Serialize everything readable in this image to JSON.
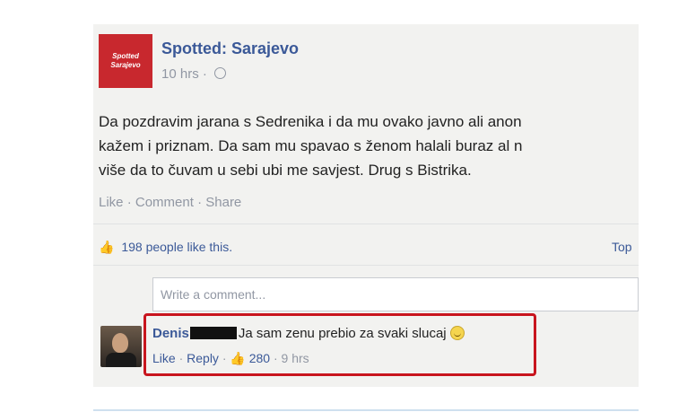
{
  "post": {
    "page_name": "Spotted: Sarajevo",
    "avatar_text_line1": "Spotted",
    "avatar_text_line2": "Sarajevo",
    "time": "10 hrs",
    "body_lines": [
      "Da pozdravim jarana s Sedrenika i da mu ovako javno ali anon",
      "kažem i priznam. Da sam mu spavao s ženom halali buraz al n",
      "više da to čuvam u sebi ubi me savjest. Drug s Bistrika."
    ],
    "actions": {
      "like": "Like",
      "comment": "Comment",
      "share": "Share"
    },
    "likes_text": "198 people like this.",
    "top_label": "Top"
  },
  "comment_input": {
    "placeholder": "Write a comment..."
  },
  "comment": {
    "author": "Denis",
    "text": "Ja sam zenu prebio za svaki slucaj",
    "like": "Like",
    "reply": "Reply",
    "like_count": "280",
    "time": "9 hrs"
  },
  "colors": {
    "highlight": "#c8151e",
    "link": "#3b5998",
    "page_avatar": "#c8282e"
  },
  "icons": [
    "globe-icon",
    "thumbs-up-icon",
    "smiley-icon"
  ]
}
